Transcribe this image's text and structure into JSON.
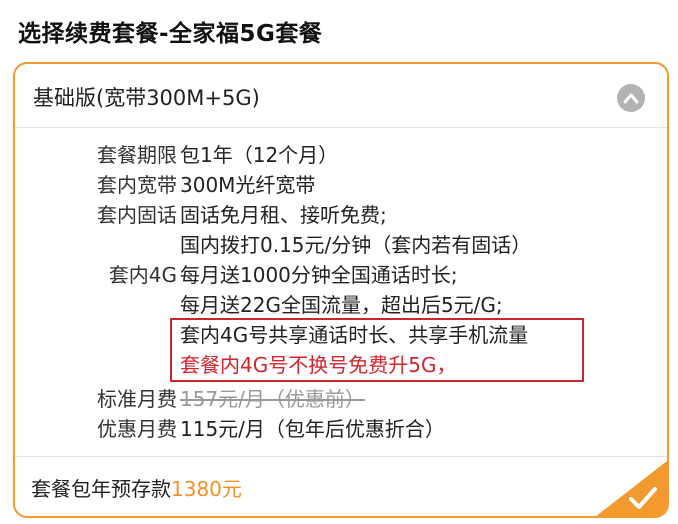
{
  "page": {
    "title": "选择续费套餐-全家福5G套餐"
  },
  "plan": {
    "name": "基础版(宽带300M+5G)",
    "expanded": true,
    "rows": {
      "period": {
        "label": "套餐期限",
        "value": "包1年（12个月）"
      },
      "broadband": {
        "label": "套内宽带",
        "value": "300M光纤宽带"
      },
      "landline": {
        "label": "套内固话",
        "value1": "固话免月租、接听免费;",
        "value2": "国内拨打0.15元/分钟（套内若有固话）"
      },
      "mobile": {
        "label": "套内4G",
        "value1": "每月送1000分钟全国通话时长;",
        "value2": "每月送22G全国流量，超出后5元/G;",
        "value3": "套内4G号共享通话时长、共享手机流量",
        "value4": "套餐内4G号不换号免费升5G，"
      },
      "standard_fee": {
        "label": "标准月费",
        "value": "157元/月（优惠前）"
      },
      "discount_fee": {
        "label": "优惠月费",
        "value": "115元/月（包年后优惠折合）"
      }
    },
    "footer": {
      "prefix": "套餐包年预存款",
      "amount": "1380元"
    }
  },
  "colors": {
    "accent_orange": "#f29a2e",
    "highlight_red": "#c9262d",
    "price_orange": "#f0912b"
  },
  "icons": {
    "collapse": "chevron-up-icon",
    "selected": "checkmark-icon"
  }
}
